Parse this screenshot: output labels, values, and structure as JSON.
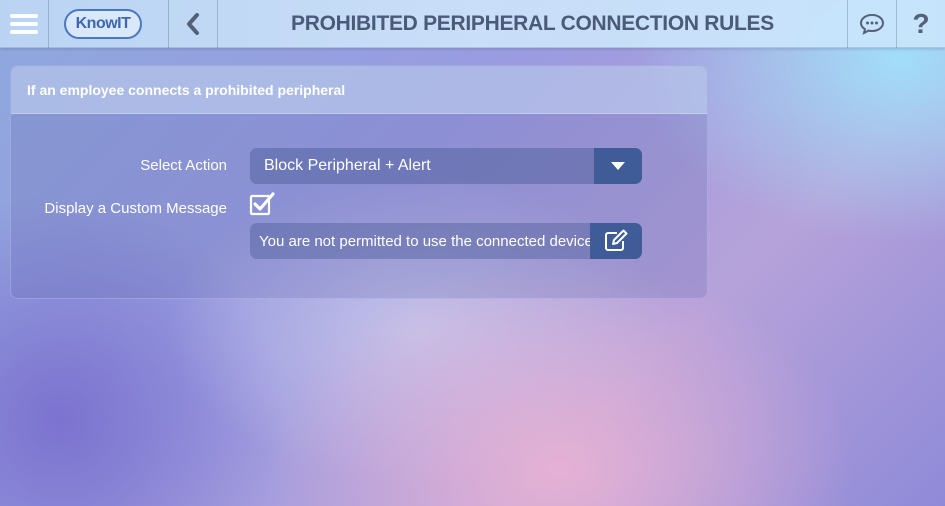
{
  "header": {
    "logo_text": "KnowIT",
    "title": "PROHIBITED PERIPHERAL CONNECTION RULES",
    "icons": {
      "menu": "hamburger-menu-icon",
      "back": "chevron-left-icon",
      "chat": "chat-bubble-icon",
      "help": "question-mark-icon"
    }
  },
  "panel": {
    "header": "If an employee connects a prohibited peripheral",
    "select_action_label": "Select Action",
    "select_action_value": "Block Peripheral + Alert",
    "custom_message_label": "Display a Custom Message",
    "custom_message_checked": true,
    "custom_message_value": "You are not permitted to use the connected device"
  },
  "colors": {
    "accent": "#3f5c98",
    "title_text": "#4a5a78",
    "logo": "#3f67b0"
  }
}
